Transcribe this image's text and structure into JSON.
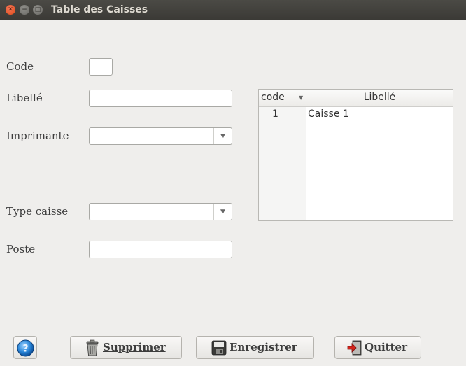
{
  "window": {
    "title": "Table des Caisses"
  },
  "form": {
    "code_label": "Code",
    "code_value": "",
    "libelle_label": "Libellé",
    "libelle_value": "",
    "imprimante_label": "Imprimante",
    "imprimante_value": "",
    "type_caisse_label": "Type caisse",
    "type_caisse_value": "",
    "poste_label": "Poste",
    "poste_value": ""
  },
  "table": {
    "columns": [
      "code",
      "Libellé"
    ],
    "rows": [
      {
        "code": "1",
        "libelle": "Caisse 1"
      }
    ]
  },
  "buttons": {
    "help_icon": "help-icon",
    "delete_label": "Supprimer",
    "save_label": "Enregistrer",
    "quit_label": "Quitter"
  }
}
